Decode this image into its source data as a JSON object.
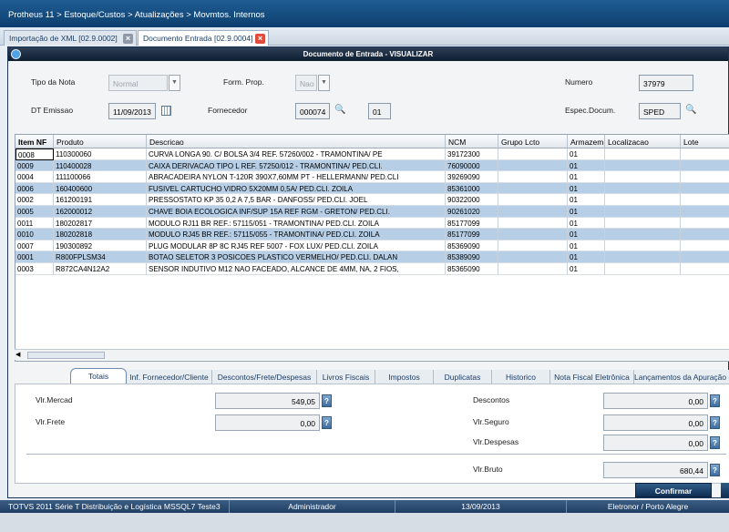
{
  "breadcrumb": "Protheus 11 > Estoque/Custos > Atualizações > Movmtos. Internos",
  "tabs": [
    {
      "label": "Importação de XML [02.9.0002]"
    },
    {
      "label": "Documento Entrada [02.9.0004]"
    }
  ],
  "window_title": "Documento de Entrada - VISUALIZAR",
  "header": {
    "tipo_nota_label": "Tipo da Nota",
    "tipo_nota_value": "Normal",
    "form_prop_label": "Form. Prop.",
    "form_prop_value": "Nao",
    "numero_label": "Numero",
    "numero_value": "37979",
    "dt_emissao_label": "DT Emissao",
    "dt_emissao_value": "11/09/2013",
    "fornecedor_label": "Fornecedor",
    "fornecedor_code": "000074",
    "fornecedor_loja": "01",
    "especie_label": "Espec.Docum.",
    "especie_value": "SPED"
  },
  "grid": {
    "columns": [
      "Item NF",
      "Produto",
      "Descricao",
      "NCM",
      "Grupo Lcto",
      "Armazem",
      "Localizacao",
      "Lote"
    ],
    "rows": [
      [
        "0008",
        "110300060",
        "CURVA LONGA 90. C/ BOLSA 3/4 REF. 57260/002 - TRAMONTINA/ PE",
        "39172300",
        "",
        "01",
        "",
        ""
      ],
      [
        "0009",
        "110400028",
        "CAIXA DERIVACAO TIPO L REF. 57250/012 - TRAMONTINA/ PED.CLI.",
        "76090000",
        "",
        "01",
        "",
        ""
      ],
      [
        "0004",
        "111100066",
        "ABRACADEIRA NYLON T-120R 390X7,60MM PT - HELLERMANN/ PED.CLI",
        "39269090",
        "",
        "01",
        "",
        ""
      ],
      [
        "0006",
        "160400600",
        "FUSIVEL CARTUCHO VIDRO 5X20MM 0,5A/ PED.CLI. ZOILA",
        "85361000",
        "",
        "01",
        "",
        ""
      ],
      [
        "0002",
        "161200191",
        "PRESSOSTATO KP 35 0,2 A 7,5 BAR - DANFOSS/ PED.CLI. JOEL",
        "90322000",
        "",
        "01",
        "",
        ""
      ],
      [
        "0005",
        "162000012",
        "CHAVE BOIA ECOLOGICA INF/SUP 15A REF RGM - GRETON/ PED.CLI.",
        "90261020",
        "",
        "01",
        "",
        ""
      ],
      [
        "0011",
        "180202817",
        "MODULO RJ11 BR REF.: 57115/051 - TRAMONTINA/ PED.CLI. ZOILA",
        "85177099",
        "",
        "01",
        "",
        ""
      ],
      [
        "0010",
        "180202818",
        "MODULO RJ45 BR REF.: 57115/055 - TRAMONTINA/ PED.CLI. ZOILA",
        "85177099",
        "",
        "01",
        "",
        ""
      ],
      [
        "0007",
        "190300892",
        "PLUG MODULAR 8P 8C RJ45 REF 5007 - FOX LUX/ PED.CLI. ZOILA",
        "85369090",
        "",
        "01",
        "",
        ""
      ],
      [
        "0001",
        "R800FPLSM34",
        "BOTAO SELETOR 3 POSICOES PLASTICO VERMELHO/ PED.CLI. DALAN",
        "85389090",
        "",
        "01",
        "",
        ""
      ],
      [
        "0003",
        "R872CA4N12A2",
        "SENSOR INDUTIVO M12 NAO FACEADO, ALCANCE DE 4MM, NA, 2 FIOS,",
        "85365090",
        "",
        "01",
        "",
        ""
      ]
    ]
  },
  "folders": [
    "Totais",
    "Inf. Fornecedor/Cliente",
    "Descontos/Frete/Despesas",
    "Livros Fiscais",
    "Impostos",
    "Duplicatas",
    "Historico",
    "Nota Fiscal Eletrônica",
    "Lançamentos da Apuração de ICMS"
  ],
  "totals": {
    "vlr_mercad_label": "Vlr.Mercad",
    "vlr_mercad": "549,05",
    "vlr_frete_label": "Vlr.Frete",
    "vlr_frete": "0,00",
    "descontos_label": "Descontos",
    "descontos": "0,00",
    "vlr_seguro_label": "Vlr.Seguro",
    "vlr_seguro": "0,00",
    "vlr_despesas_label": "Vlr.Despesas",
    "vlr_despesas": "0,00",
    "vlr_bruto_label": "Vlr.Bruto",
    "vlr_bruto": "680,44",
    "help_label": "?"
  },
  "confirm_label": "Confirmar",
  "status": {
    "system": "TOTVS 2011 Série T Distribuição e Logística MSSQL7 Teste3",
    "user": "Administrador",
    "date": "13/09/2013",
    "company": "Eletronor / Porto Alegre"
  }
}
